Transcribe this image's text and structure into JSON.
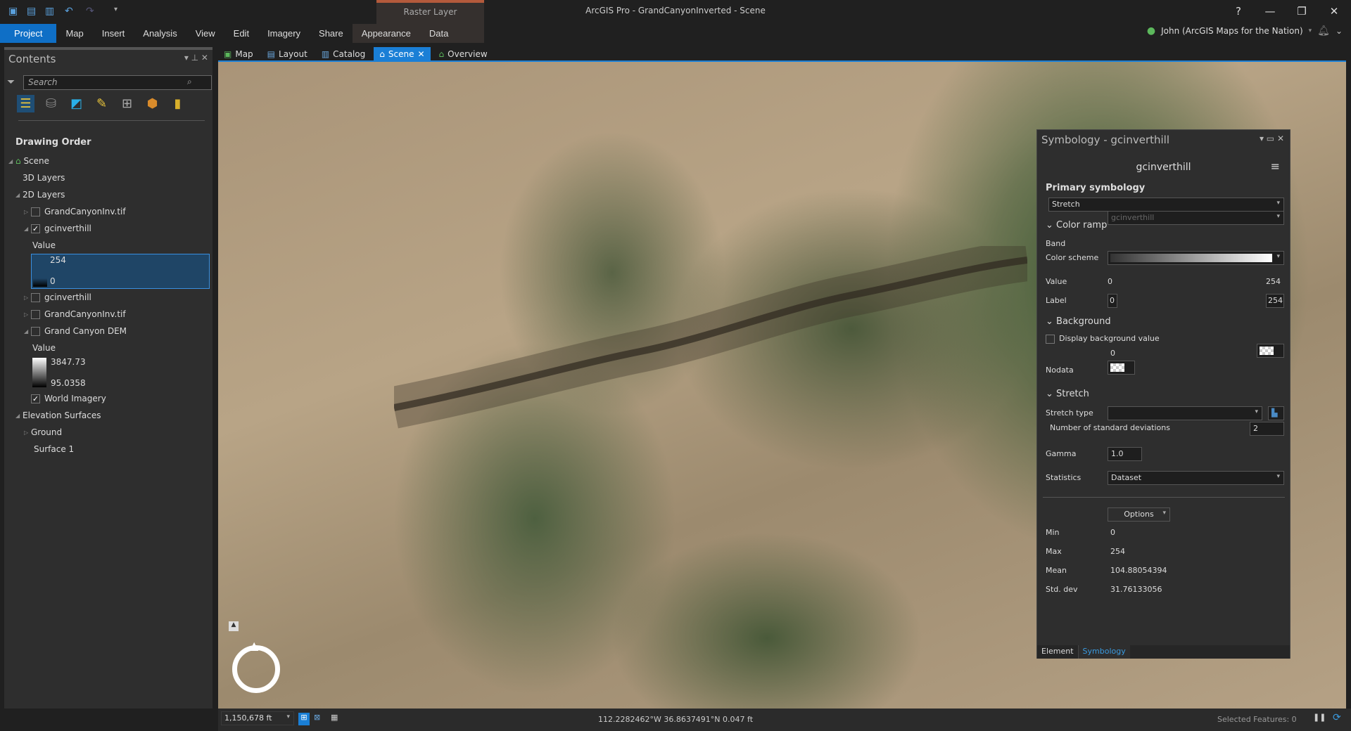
{
  "app": {
    "title": "ArcGIS Pro - GrandCanyonInverted - Scene",
    "context_tab": "Raster Layer",
    "help": "?",
    "minimize": "—",
    "restore": "❐",
    "close": "✕"
  },
  "ribbon": {
    "tabs": [
      "Project",
      "Map",
      "Insert",
      "Analysis",
      "View",
      "Edit",
      "Imagery",
      "Share",
      "Appearance",
      "Data"
    ]
  },
  "user": {
    "name": "John (ArcGIS Maps for the Nation)"
  },
  "contents": {
    "title": "Contents",
    "search_placeholder": "Search",
    "section": "Drawing Order",
    "tree": {
      "scene": "Scene",
      "layers3d": "3D Layers",
      "layers2d": "2D Layers",
      "l1": "GrandCanyonInv.tif",
      "l2": "gcinverthill",
      "l2_value": "Value",
      "l2_max": "254",
      "l2_min": "0",
      "l3": "gcinverthill",
      "l4": "GrandCanyonInv.tif",
      "l5": "Grand Canyon DEM",
      "l5_value": "Value",
      "l5_max": "3847.73",
      "l5_min": "95.0358",
      "l6": "World Imagery",
      "elev": "Elevation Surfaces",
      "ground": "Ground",
      "surface": "Surface 1"
    }
  },
  "viewtabs": [
    "Map",
    "Layout",
    "Catalog",
    "Scene",
    "Overview"
  ],
  "status": {
    "scale": "1,150,678 ft",
    "coords": "112.2282462°W 36.8637491°N  0.047 ft",
    "selected": "Selected Features: 0"
  },
  "symbology": {
    "title": "Symbology - gcinverthill",
    "layer": "gcinverthill",
    "primary_label": "Primary symbology",
    "primary": "Stretch",
    "color_ramp": "Color ramp",
    "band_label": "Band",
    "band": "gcinverthill",
    "scheme_label": "Color scheme",
    "value_label": "Value",
    "value_min": "0",
    "value_max": "254",
    "label_label": "Label",
    "label_min": "0",
    "label_max": "254",
    "background": "Background",
    "display_bg": "Display background value",
    "bg_value": "0",
    "nodata": "Nodata",
    "stretch": "Stretch",
    "stretch_type": "Stretch type",
    "num_std": "Number of standard deviations",
    "num_std_value": "2",
    "gamma_label": "Gamma",
    "gamma": "1.0",
    "statistics_label": "Statistics",
    "statistics": "Dataset",
    "options": "Options",
    "min_label": "Min",
    "min": "0",
    "max_label": "Max",
    "max": "254",
    "mean_label": "Mean",
    "mean": "104.88054394",
    "std_label": "Std. dev",
    "std": "31.76133056",
    "tab_element": "Element",
    "tab_symbology": "Symbology"
  }
}
